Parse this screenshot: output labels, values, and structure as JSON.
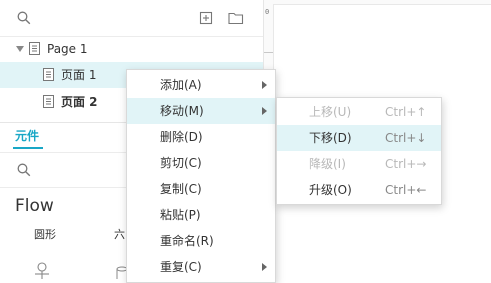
{
  "pages_panel": {
    "tree": [
      {
        "label": "Page 1",
        "bold": false
      },
      {
        "label": "页面 1",
        "bold": false
      },
      {
        "label": "页面 2",
        "bold": true
      }
    ]
  },
  "libraries_panel": {
    "tab_label": "元件",
    "library_title": "Flow",
    "shapes": [
      "圆形",
      "六"
    ]
  },
  "ruler": {
    "top_label": "0"
  },
  "context_menu": {
    "items": [
      {
        "label": "添加(A)",
        "submenu": true
      },
      {
        "label": "移动(M)",
        "submenu": true
      },
      {
        "label": "删除(D)",
        "submenu": false
      },
      {
        "label": "剪切(C)",
        "submenu": false
      },
      {
        "label": "复制(C)",
        "submenu": false
      },
      {
        "label": "粘贴(P)",
        "submenu": false
      },
      {
        "label": "重命名(R)",
        "submenu": false
      },
      {
        "label": "重复(C)",
        "submenu": true
      }
    ]
  },
  "move_submenu": {
    "items": [
      {
        "label": "上移(U)",
        "shortcut": "Ctrl+↑",
        "enabled": false
      },
      {
        "label": "下移(D)",
        "shortcut": "Ctrl+↓",
        "enabled": true
      },
      {
        "label": "降级(I)",
        "shortcut": "Ctrl+→",
        "enabled": false
      },
      {
        "label": "升级(O)",
        "shortcut": "Ctrl+←",
        "enabled": true
      }
    ]
  },
  "colors": {
    "accent": "#19a7c6",
    "selection": "#e1f4f7"
  }
}
